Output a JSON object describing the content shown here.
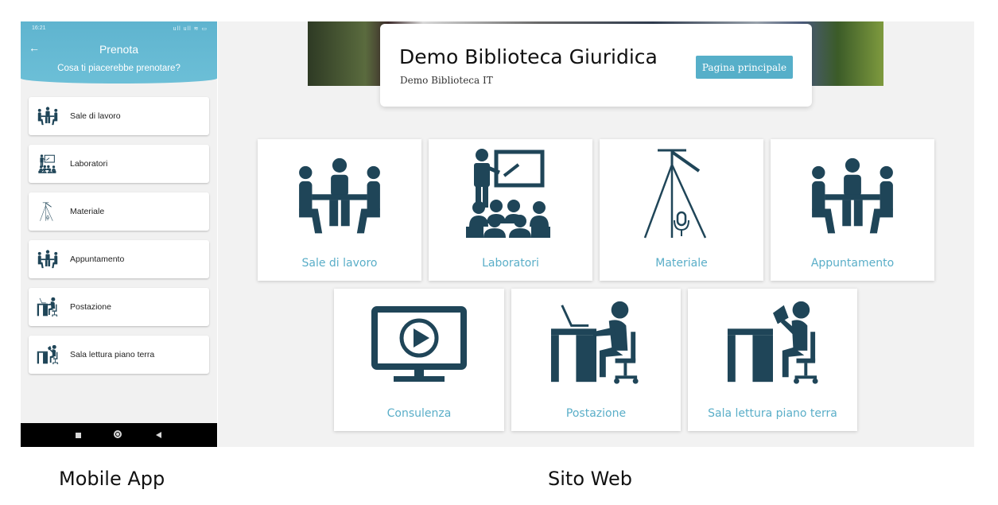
{
  "mobile": {
    "status_time": "16:21",
    "status_icons": "ull ull ≋ ▭",
    "title": "Prenota",
    "subtitle": "Cosa ti piacerebbe prenotare?",
    "items": [
      {
        "label": "Sale di lavoro",
        "icon": "meeting-icon"
      },
      {
        "label": "Laboratori",
        "icon": "presentation-icon"
      },
      {
        "label": "Materiale",
        "icon": "tripod-mic-icon"
      },
      {
        "label": "Appuntamento",
        "icon": "meeting-icon"
      },
      {
        "label": "Postazione",
        "icon": "desk-laptop-icon"
      },
      {
        "label": "Sala lettura piano terra",
        "icon": "desk-reading-icon"
      }
    ]
  },
  "web": {
    "site_title": "Demo Biblioteca Giuridica",
    "site_subtitle": "Demo Biblioteca IT",
    "home_button": "Pagina principale",
    "tiles": [
      {
        "label": "Sale di lavoro",
        "icon": "meeting-icon"
      },
      {
        "label": "Laboratori",
        "icon": "presentation-icon"
      },
      {
        "label": "Materiale",
        "icon": "tripod-mic-icon"
      },
      {
        "label": "Appuntamento",
        "icon": "meeting-icon"
      },
      {
        "label": "Consulenza",
        "icon": "video-monitor-icon"
      },
      {
        "label": "Postazione",
        "icon": "desk-laptop-icon"
      },
      {
        "label": "Sala lettura piano terra",
        "icon": "desk-reading-icon"
      }
    ]
  },
  "captions": {
    "left": "Mobile App",
    "right": "Sito Web"
  },
  "colors": {
    "header": "#5fb4cf",
    "accent": "#56afc9",
    "icon_dark": "#1f4558",
    "tile_label": "#5aaec8"
  }
}
